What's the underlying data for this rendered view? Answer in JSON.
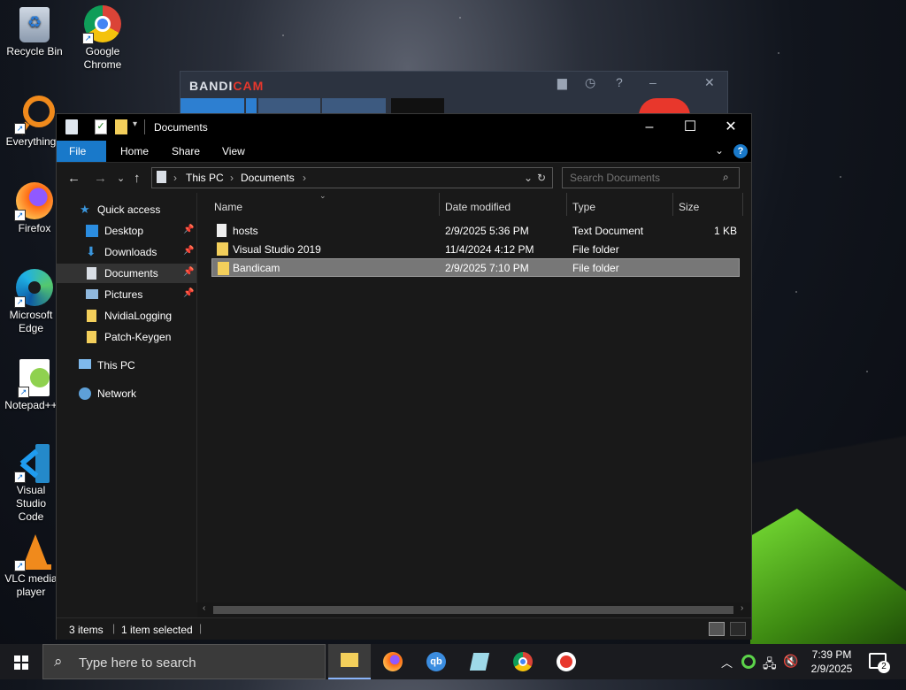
{
  "desktop": {
    "icons": [
      {
        "label": "Recycle Bin"
      },
      {
        "label": "Google Chrome"
      },
      {
        "label": "Everything"
      },
      {
        "label": "Firefox"
      },
      {
        "label": "Microsoft Edge"
      },
      {
        "label": "Notepad++"
      },
      {
        "label": "Visual Studio Code"
      },
      {
        "label": "VLC media player"
      }
    ]
  },
  "bandicam": {
    "logo_a": "BANDI",
    "logo_b": "CAM"
  },
  "explorer": {
    "title": "Documents",
    "ribbon": {
      "file": "File",
      "home": "Home",
      "share": "Share",
      "view": "View"
    },
    "address": {
      "root": "This PC",
      "current": "Documents"
    },
    "search_placeholder": "Search Documents",
    "nav": {
      "quick_access": "Quick access",
      "desktop": "Desktop",
      "downloads": "Downloads",
      "documents": "Documents",
      "pictures": "Pictures",
      "nvidia": "NvidiaLogging",
      "patch": "Patch-Keygen",
      "this_pc": "This PC",
      "network": "Network"
    },
    "columns": {
      "name": "Name",
      "date": "Date modified",
      "type": "Type",
      "size": "Size"
    },
    "files": [
      {
        "name": "hosts",
        "date": "2/9/2025 5:36 PM",
        "type": "Text Document",
        "size": "1 KB"
      },
      {
        "name": "Visual Studio 2019",
        "date": "11/4/2024 4:12 PM",
        "type": "File folder",
        "size": ""
      },
      {
        "name": "Bandicam",
        "date": "2/9/2025 7:10 PM",
        "type": "File folder",
        "size": ""
      }
    ],
    "status": {
      "items": "3 items",
      "selected": "1 item selected"
    }
  },
  "taskbar": {
    "search_placeholder": "Type here to search",
    "time": "7:39 PM",
    "date": "2/9/2025",
    "notifications": "2"
  },
  "colors": {
    "accent": "#1979ca",
    "folder": "#f3cf5b"
  }
}
